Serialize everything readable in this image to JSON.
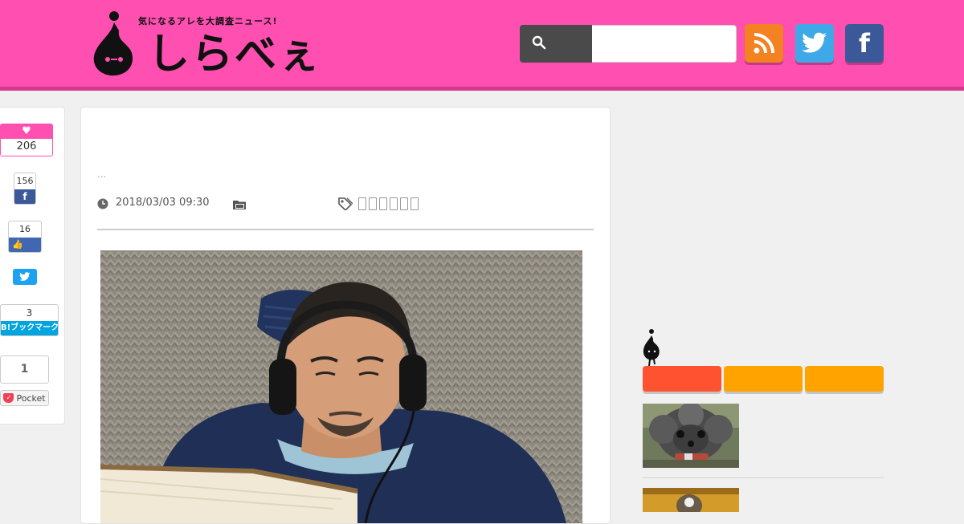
{
  "header": {
    "logo_tagline": "気になるアレを大調査ニュース!",
    "logo_text": "しらべぇ",
    "search": {
      "placeholder": "",
      "value": ""
    },
    "colors": {
      "header_bg": "#ff4fb1",
      "rss": "#f58220",
      "twitter": "#3fa9e8",
      "facebook": "#3b5998"
    },
    "icons": [
      "search-icon",
      "rss-icon",
      "twitter-icon",
      "facebook-icon"
    ]
  },
  "share": {
    "like_count": "206",
    "facebook_share_count": "156",
    "facebook_like_count": "16",
    "hatena_count": "3",
    "hatena_label": "B!ブックマーク",
    "pocket_count": "1",
    "pocket_label": "Pocket"
  },
  "article": {
    "excerpt": "...",
    "date": "2018/03/03 09:30",
    "tags_placeholder_count": 6
  },
  "sidebar": {
    "tab_colors": [
      "#ff5230",
      "#ffa300",
      "#ffa300"
    ]
  }
}
